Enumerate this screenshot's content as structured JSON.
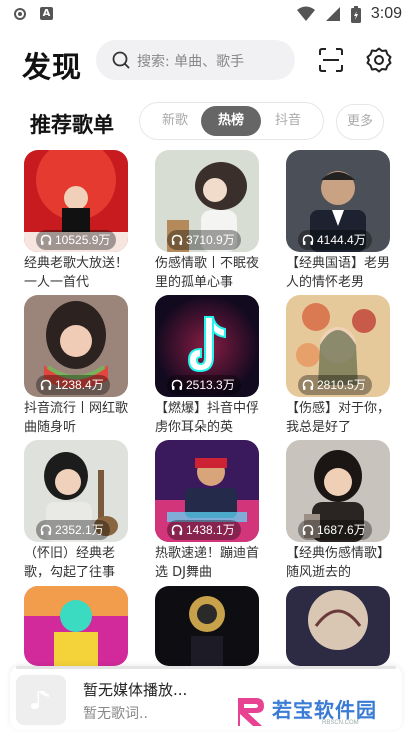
{
  "statusbar": {
    "time": "3:09"
  },
  "header": {
    "title": "发现",
    "search_placeholder": "搜索: 单曲、歌手",
    "scan_icon": "scan-icon",
    "settings_icon": "gear-icon"
  },
  "section": {
    "title": "推荐歌单",
    "tabs": [
      {
        "label": "新歌",
        "active": false
      },
      {
        "label": "热榜",
        "active": true
      },
      {
        "label": "抖音",
        "active": false
      }
    ],
    "more_label": "更多"
  },
  "playlists": [
    {
      "count": "10525.9万",
      "name": "经典老歌大放送！一人一首代"
    },
    {
      "count": "3710.9万",
      "name": "伤感情歌丨不眠夜里的孤单心事"
    },
    {
      "count": "4144.4万",
      "name": "【经典国语】老男人的情怀老男"
    },
    {
      "count": "1238.4万",
      "name": "抖音流行丨网红歌曲随身听"
    },
    {
      "count": "2513.3万",
      "name": "【燃爆】抖音中俘虏你耳朵的英"
    },
    {
      "count": "2810.5万",
      "name": "【伤感】对于你，我总是好了"
    },
    {
      "count": "2352.1万",
      "name": "（怀旧）经典老歌，勾起了往事"
    },
    {
      "count": "1438.1万",
      "name": "热歌速递！蹦迪首选 DJ舞曲"
    },
    {
      "count": "1687.6万",
      "name": "【经典伤感情歌】随风逝去的"
    },
    {
      "count": "",
      "name": ""
    },
    {
      "count": "",
      "name": ""
    },
    {
      "count": "",
      "name": ""
    }
  ],
  "player": {
    "title": "暂无媒体播放...",
    "subtitle": "暂无歌词..",
    "icon": "music-note-icon"
  },
  "watermark": {
    "text": "若宝软件园",
    "sub": "RBSCN.COM"
  }
}
